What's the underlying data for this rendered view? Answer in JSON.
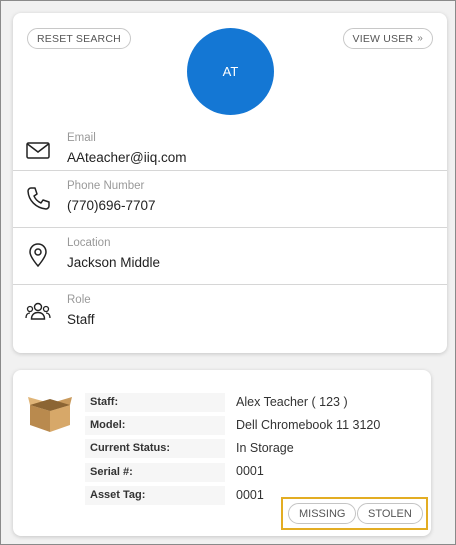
{
  "user": {
    "reset_label": "RESET SEARCH",
    "view_user_label": "VIEW USER",
    "view_user_chevron": "»",
    "initials": "AT",
    "avatar_color": "#1477d4",
    "fields": [
      {
        "icon": "envelope-icon",
        "label": "Email",
        "value": "AAteacher@iiq.com"
      },
      {
        "icon": "phone-icon",
        "label": "Phone Number",
        "value": "(770)696-7707"
      },
      {
        "icon": "map-pin-icon",
        "label": "Location",
        "value": "Jackson Middle"
      },
      {
        "icon": "people-icon",
        "label": "Role",
        "value": "Staff"
      }
    ]
  },
  "asset": {
    "icon": "cardboard-box-icon",
    "rows": [
      {
        "label": "Staff:",
        "value": "Alex Teacher ( 123 )"
      },
      {
        "label": "Model:",
        "value": "Dell Chromebook 11 3120"
      },
      {
        "label": "Current Status:",
        "value": "In Storage"
      },
      {
        "label": "Serial #:",
        "value": "0001"
      },
      {
        "label": "Asset Tag:",
        "value": "0001"
      }
    ],
    "missing_label": "MISSING",
    "stolen_label": "STOLEN",
    "highlight_color": "#e3ad23"
  }
}
